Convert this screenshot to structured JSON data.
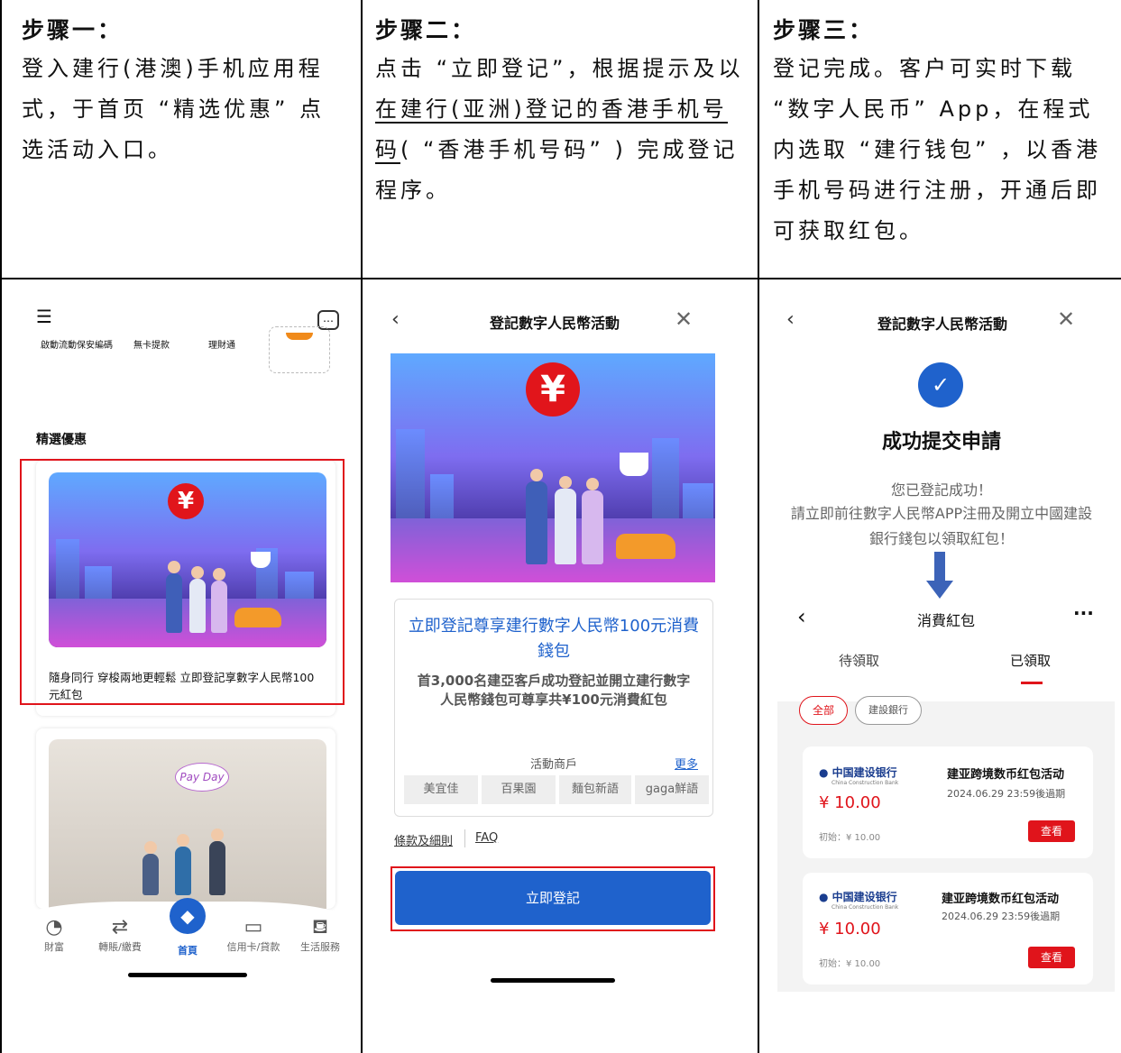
{
  "steps": [
    {
      "title": "步骤一：",
      "text": "登入建行(港澳)手机应用程式，于首页 “精选优惠” 点选活动入口。"
    },
    {
      "title": "步骤二：",
      "text_before": "点击 “立即登记”，根据提示及以",
      "text_underline": "在建行(亚洲)登记的香港手机号码",
      "text_after": "( “香港手机号码” ) 完成登记程序。"
    },
    {
      "title": "步骤三：",
      "text": "登记完成。客户可实时下载 “数字人民币” App，在程式内选取 “建行钱包” ，以香港手机号码进行注册，开通后即可获取红包。"
    }
  ],
  "phone1": {
    "quick_actions": [
      "啟動流動保安編碼",
      "無卡提款",
      "理財通"
    ],
    "section_title": "精選優惠",
    "promo_caption": "隨身同行 穿梭兩地更輕鬆 立即登記享數字人民幣100元紅包",
    "banner2_text": "Pay Day",
    "tabs": [
      {
        "label": "財富",
        "icon": "wealth-icon"
      },
      {
        "label": "轉賬/繳費",
        "icon": "transfer-icon"
      },
      {
        "label": "首頁",
        "icon": "home-icon"
      },
      {
        "label": "信用卡/貸款",
        "icon": "card-icon"
      },
      {
        "label": "生活服務",
        "icon": "life-service-icon"
      }
    ]
  },
  "phone2": {
    "nav_title": "登記數字人民幣活動",
    "promo_title": "立即登記尊享建行數字人民幣100元消費錢包",
    "promo_desc": "首3,000名建亞客戶成功登記並開立建行數字人民幣錢包可尊享共¥100元消費紅包",
    "merchant_label": "活動商戶",
    "more": "更多",
    "merchants": [
      "美宜佳",
      "百果園",
      "麵包新語",
      "gaga鮮語"
    ],
    "terms": "條款及細則",
    "faq": "FAQ",
    "register_button": "立即登記"
  },
  "phone3": {
    "nav_title": "登記數字人民幣活動",
    "success_title": "成功提交申請",
    "success_line1": "您已登記成功！",
    "success_line2": "請立即前往數字人民幣APP注冊及開立中國建設銀行錢包以領取紅包！",
    "wallet_title": "消費紅包",
    "tab_pending": "待領取",
    "tab_received": "已領取",
    "filter_all": "全部",
    "filter_bank": "建設銀行",
    "bank_name": "中国建设银行",
    "bank_name_en": "China Construction Bank",
    "envelopes": [
      {
        "name": "建亚跨境数币红包活动",
        "expiry": "2024.06.29 23:59後過期",
        "amount": "¥ 10.00",
        "initial": "初始：¥ 10.00",
        "action": "查看"
      },
      {
        "name": "建亚跨境数币红包活动",
        "expiry": "2024.06.29 23:59後過期",
        "amount": "¥ 10.00",
        "initial": "初始：¥ 10.00",
        "action": "查看"
      }
    ]
  },
  "colors": {
    "accent_red": "#e0141b",
    "primary_blue": "#1f62cc",
    "link_blue": "#1f62cc"
  }
}
